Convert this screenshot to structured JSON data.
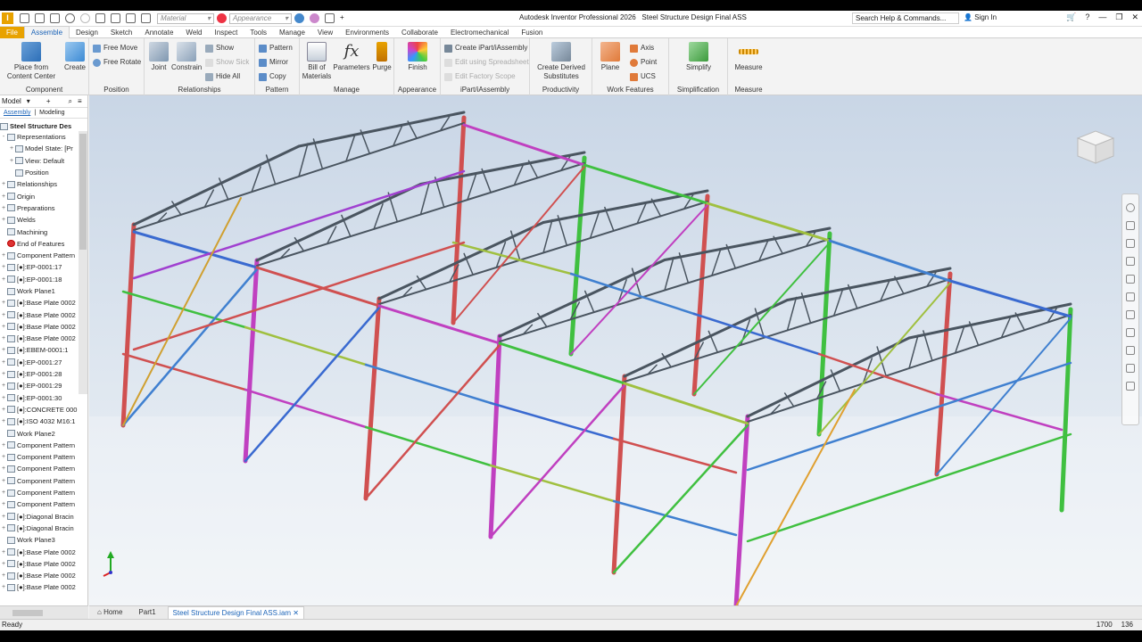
{
  "app": {
    "title": "Autodesk Inventor Professional 2026",
    "document_title": "Steel Structure Design Final ASS",
    "material_combo": "Material",
    "appearance_combo": "Appearance",
    "search_placeholder": "Search Help & Commands...",
    "sign_in": "Sign In"
  },
  "tabs": [
    "File",
    "Assemble",
    "Design",
    "Sketch",
    "Annotate",
    "Weld",
    "Inspect",
    "Tools",
    "Manage",
    "View",
    "Environments",
    "Collaborate",
    "Electromechanical",
    "Fusion"
  ],
  "ribbon": {
    "component": {
      "name": "Component",
      "place": "Place from\nContent Center",
      "create": "Create"
    },
    "position": {
      "name": "Position",
      "free_move": "Free Move",
      "free_rotate": "Free Rotate"
    },
    "relationships": {
      "name": "Relationships",
      "joint": "Joint",
      "constrain": "Constrain",
      "show": "Show",
      "show_sick": "Show Sick",
      "hide_all": "Hide All"
    },
    "pattern": {
      "name": "Pattern",
      "pattern": "Pattern",
      "mirror": "Mirror",
      "copy": "Copy"
    },
    "manage": {
      "name": "Manage",
      "bom": "Bill of\nMaterials",
      "parameters": "Parameters",
      "purge": "Purge"
    },
    "appearance": {
      "name": "Appearance",
      "finish": "Finish"
    },
    "ipart": {
      "name": "iPart/iAssembly",
      "create": "Create iPart/iAssembly",
      "edit_spreadsheet": "Edit using Spreadsheet",
      "edit_factory": "Edit Factory Scope"
    },
    "productivity": {
      "name": "Productivity",
      "create_derived": "Create Derived\nSubstitutes"
    },
    "work_features": {
      "name": "Work Features",
      "plane": "Plane",
      "axis": "Axis",
      "point": "Point",
      "ucs": "UCS"
    },
    "simplification": {
      "name": "Simplification",
      "simplify": "Simplify"
    },
    "measure": {
      "name": "Measure",
      "measure": "Measure"
    }
  },
  "browser": {
    "header": "Model",
    "tab_assembly": "Assembly",
    "tab_modeling": "Modeling",
    "root": "Steel Structure Des",
    "items": [
      {
        "label": "Representations",
        "toggle": "-",
        "indent": 0
      },
      {
        "label": "Model State: [Pr",
        "toggle": "+",
        "indent": 1
      },
      {
        "label": "View: Default",
        "toggle": "+",
        "indent": 1
      },
      {
        "label": "Position",
        "toggle": "",
        "indent": 1
      },
      {
        "label": "Relationships",
        "toggle": "+",
        "indent": 0
      },
      {
        "label": "Origin",
        "toggle": "+",
        "indent": 0
      },
      {
        "label": "Preparations",
        "toggle": "+",
        "indent": 0
      },
      {
        "label": "Welds",
        "toggle": "+",
        "indent": 0
      },
      {
        "label": "Machining",
        "toggle": "",
        "indent": 0
      },
      {
        "label": "End of Features",
        "toggle": "",
        "indent": 0,
        "red": true
      },
      {
        "label": "Component Pattern",
        "toggle": "+",
        "indent": 0
      },
      {
        "label": "[●]:EP-0001:17",
        "toggle": "+",
        "indent": 0
      },
      {
        "label": "[●]:EP-0001:18",
        "toggle": "+",
        "indent": 0
      },
      {
        "label": "Work Plane1",
        "toggle": "",
        "indent": 0
      },
      {
        "label": "[●]:Base Plate 0002",
        "toggle": "+",
        "indent": 0
      },
      {
        "label": "[●]:Base Plate 0002",
        "toggle": "+",
        "indent": 0
      },
      {
        "label": "[●]:Base Plate 0002",
        "toggle": "+",
        "indent": 0
      },
      {
        "label": "[●]:Base Plate 0002",
        "toggle": "+",
        "indent": 0
      },
      {
        "label": "[●]:EBEM-0001:1",
        "toggle": "+",
        "indent": 0
      },
      {
        "label": "[●]:EP-0001:27",
        "toggle": "+",
        "indent": 0
      },
      {
        "label": "[●]:EP-0001:28",
        "toggle": "+",
        "indent": 0
      },
      {
        "label": "[●]:EP-0001:29",
        "toggle": "+",
        "indent": 0
      },
      {
        "label": "[●]:EP-0001:30",
        "toggle": "+",
        "indent": 0
      },
      {
        "label": "[●]:CONCRETE 000",
        "toggle": "+",
        "indent": 0
      },
      {
        "label": "[●]:ISO 4032 M16:1",
        "toggle": "+",
        "indent": 0
      },
      {
        "label": "Work Plane2",
        "toggle": "",
        "indent": 0
      },
      {
        "label": "Component Pattern",
        "toggle": "+",
        "indent": 0
      },
      {
        "label": "Component Pattern",
        "toggle": "+",
        "indent": 0
      },
      {
        "label": "Component Pattern",
        "toggle": "+",
        "indent": 0
      },
      {
        "label": "Component Pattern",
        "toggle": "+",
        "indent": 0
      },
      {
        "label": "Component Pattern",
        "toggle": "+",
        "indent": 0
      },
      {
        "label": "Component Pattern",
        "toggle": "+",
        "indent": 0
      },
      {
        "label": "[●]:Diagonal Bracin",
        "toggle": "+",
        "indent": 0
      },
      {
        "label": "[●]:Diagonal Bracin",
        "toggle": "+",
        "indent": 0
      },
      {
        "label": "Work Plane3",
        "toggle": "",
        "indent": 0
      },
      {
        "label": "[●]:Base Plate 0002",
        "toggle": "+",
        "indent": 0
      },
      {
        "label": "[●]:Base Plate 0002",
        "toggle": "+",
        "indent": 0
      },
      {
        "label": "[●]:Base Plate 0002",
        "toggle": "+",
        "indent": 0
      },
      {
        "label": "[●]:Base Plate 0002",
        "toggle": "+",
        "indent": 0
      }
    ]
  },
  "viewcube": {
    "top": "RIGHT",
    "front": "BACK"
  },
  "doc_tabs": [
    "Home",
    "Part1",
    "Steel Structure Design Final ASS.iam"
  ],
  "status": {
    "text": "Ready",
    "x": "1700",
    "y": "136"
  },
  "colors": {
    "accent": "#1c64b8",
    "file_tab": "#e8a200",
    "column_red": "#d05050",
    "column_pink": "#c040c0",
    "column_green": "#40c040",
    "truss_dark": "#4a5560"
  }
}
